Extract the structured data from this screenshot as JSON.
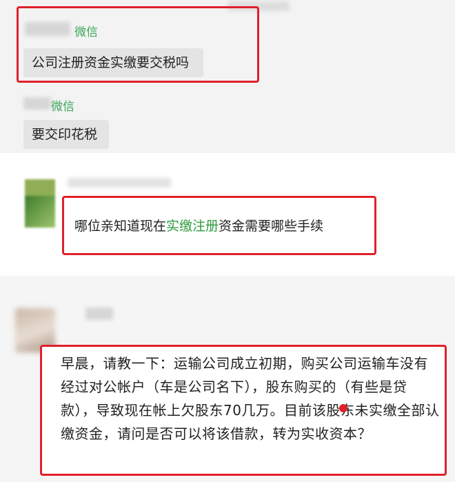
{
  "chat": {
    "msg1": {
      "source": "微信",
      "text": "公司注册资金实缴要交税吗"
    },
    "msg2": {
      "source": "微信",
      "text": "要交印花税"
    },
    "msg3": {
      "text_before": "哪位亲知道现在",
      "text_highlight": "实缴注册",
      "text_after": "资金需要哪些手续"
    },
    "msg4": {
      "text": "早晨，请教一下：运输公司成立初期，购买公司运输车没有经过对公帐户（车是公司名下），股东购买的（有些是贷款），导致现在帐上欠股东70几万。目前该股东未实缴全部认缴资金，请问是否可以将该借款，转为实收资本？"
    }
  },
  "colors": {
    "highlight_box": "#e0202a",
    "wechat_green": "#3aa55a",
    "link_green": "#2f9a3e"
  }
}
